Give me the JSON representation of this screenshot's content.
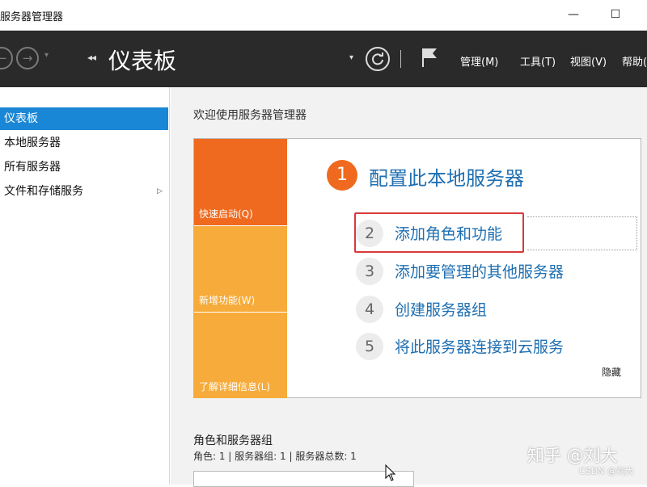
{
  "window": {
    "title": "服务器管理器",
    "minimize_glyph": "—",
    "maximize_glyph": "☐"
  },
  "header": {
    "back_icon": "arrow-left-icon",
    "forward_icon": "arrow-right-icon",
    "breadcrumb_arrows": "◂◂",
    "title": "仪表板",
    "dropdown_glyph": "▾",
    "refresh_icon": "refresh-icon",
    "flag_icon": "flag-icon",
    "menu": [
      "管理(M)",
      "工具(T)",
      "视图(V)",
      "帮助(H)"
    ]
  },
  "sidebar": {
    "items": [
      {
        "label": "仪表板",
        "active": true
      },
      {
        "label": "本地服务器",
        "active": false
      },
      {
        "label": "所有服务器",
        "active": false
      },
      {
        "label": "文件和存储服务",
        "active": false,
        "has_submenu": true
      }
    ],
    "submenu_glyph": "▷"
  },
  "main": {
    "welcome": "欢迎使用服务器管理器",
    "tiles": [
      "快速启动(Q)",
      "新增功能(W)",
      "了解详细信息(L)"
    ],
    "step1": {
      "num": "1",
      "label": "配置此本地服务器"
    },
    "steps": [
      {
        "num": "2",
        "label": "添加角色和功能"
      },
      {
        "num": "3",
        "label": "添加要管理的其他服务器"
      },
      {
        "num": "4",
        "label": "创建服务器组"
      },
      {
        "num": "5",
        "label": "将此服务器连接到云服务"
      }
    ],
    "hide": "隐藏",
    "roles_heading": "角色和服务器组",
    "roles_summary": "角色: 1 | 服务器组: 1 | 服务器总数: 1"
  },
  "watermark": {
    "line1": "知乎 @刘大",
    "line2": "CSDN @刘大"
  },
  "colors": {
    "header_bg": "#2a2a2a",
    "accent_blue": "#1a87d6",
    "tile_orange": "#ef6a1f",
    "tile_amber": "#f6ab3a",
    "link_blue": "#1f6fb2",
    "highlight_red": "#d83a3a"
  }
}
